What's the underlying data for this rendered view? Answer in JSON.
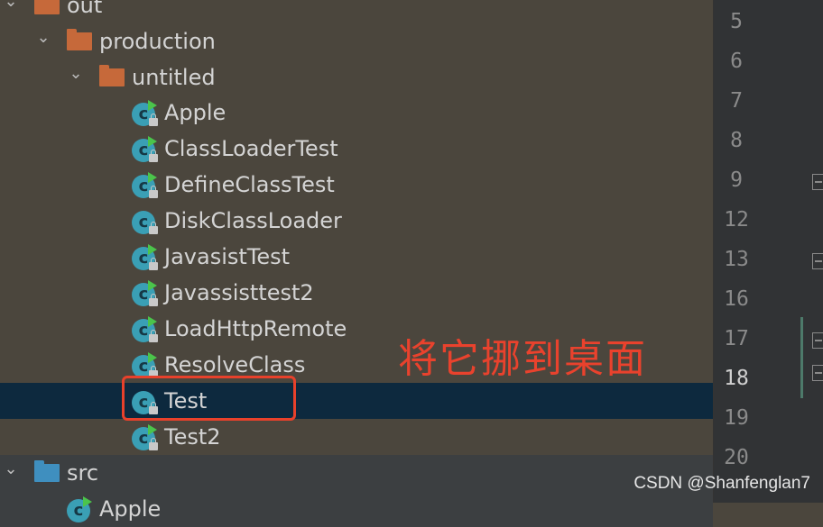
{
  "tree": {
    "out": {
      "label": "out"
    },
    "production": {
      "label": "production"
    },
    "untitled": {
      "label": "untitled"
    },
    "classes": [
      {
        "label": "Apple"
      },
      {
        "label": "ClassLoaderTest"
      },
      {
        "label": "DefineClassTest"
      },
      {
        "label": "DiskClassLoader"
      },
      {
        "label": "JavasistTest"
      },
      {
        "label": "Javassisttest2"
      },
      {
        "label": "LoadHttpRemote"
      },
      {
        "label": "ResolveClass"
      },
      {
        "label": "Test"
      },
      {
        "label": "Test2"
      }
    ],
    "src": {
      "label": "src"
    },
    "partial_next": {
      "label": "Apple"
    }
  },
  "annotation": {
    "text": "将它挪到桌面",
    "color": "#e9422d"
  },
  "gutter": {
    "line_numbers": [
      "5",
      "6",
      "7",
      "8",
      "9",
      "12",
      "13",
      "16",
      "17",
      "18",
      "19",
      "20"
    ],
    "current_line": "18"
  },
  "watermark": {
    "text": "CSDN @Shanfenglan7"
  },
  "colors": {
    "selection": "#0d293e",
    "folder_orange": "#c6693a",
    "folder_blue": "#3f8fbf",
    "class_icon": "#3a9fb5"
  }
}
